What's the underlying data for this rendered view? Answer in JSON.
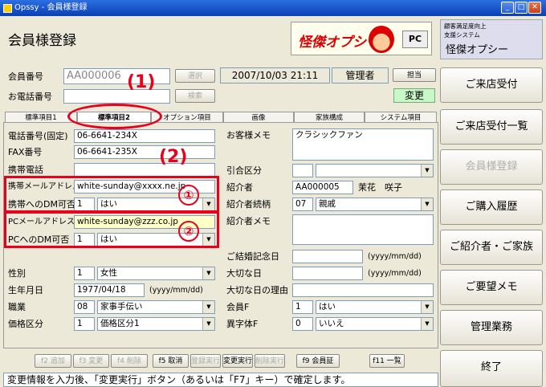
{
  "window": {
    "title": "Opssy - 会員様登録"
  },
  "header": {
    "page_title": "会員様登録",
    "logo_text": "怪傑オプシー",
    "pc_badge": "PC",
    "system_small1": "顧客満足度向上",
    "system_small2": "支援システム",
    "system_name": "怪傑オプシー"
  },
  "top": {
    "member_no_label": "会員番号",
    "member_no_value": "AA000006",
    "select_button": "選択",
    "datetime": "2007/10/03 21:11",
    "role": "管理者",
    "charge_button": "担当",
    "phone_label": "お電話番号",
    "search_button": "検索",
    "change_badge": "変更"
  },
  "tabs": [
    "標準項目1",
    "標準項目2",
    "オプション項目",
    "画像",
    "家族構成",
    "システム項目"
  ],
  "left": {
    "tel_label": "電話番号(固定)",
    "tel_value": "06-6641-234X",
    "fax_label": "FAX番号",
    "fax_value": "06-6641-235X",
    "mobile_label": "携帯電話",
    "mobile_value": "",
    "mobile_mail_label": "携帯メールアドレス",
    "mobile_mail_value": "white-sunday@xxxx.ne.jp",
    "mobile_dm_label": "携帯へのDM可否",
    "mobile_dm_code": "1",
    "mobile_dm_value": "はい",
    "pc_mail_label": "PCメールアドレス",
    "pc_mail_value": "white-sunday@zzz.co.jp",
    "pc_dm_label": "PCへのDM可否",
    "pc_dm_code": "1",
    "pc_dm_value": "はい",
    "gender_label": "性別",
    "gender_code": "1",
    "gender_value": "女性",
    "birth_label": "生年月日",
    "birth_value": "1977/04/18",
    "birth_hint": "(yyyy/mm/dd)",
    "job_label": "職業",
    "job_code": "08",
    "job_value": "家事手伝い",
    "price_label": "価格区分",
    "price_code": "1",
    "price_value": "価格区分1"
  },
  "right": {
    "memo_label": "お客様メモ",
    "memo_value": "クラシックファン",
    "transfer_label": "引合区分",
    "introducer_label": "紹介者",
    "introducer_no": "AA000005",
    "introducer_name": "茉花　咲子",
    "relation_label": "紹介者続柄",
    "relation_code": "07",
    "relation_value": "親戚",
    "introducer_memo_label": "紹介者メモ",
    "wedding_label": "ご結婚記念日",
    "wedding_hint": "(yyyy/mm/dd)",
    "important_label": "大切な日",
    "important_hint": "(yyyy/mm/dd)",
    "important_reason_label": "大切な日の理由",
    "member_f_label": "会員F",
    "member_f_code": "1",
    "member_f_value": "はい",
    "foreign_label": "異字体F",
    "foreign_code": "0",
    "foreign_value": "いいえ"
  },
  "annotations": {
    "n1": "(1)",
    "n2": "(2)",
    "c1": "①",
    "c2": "②"
  },
  "fkeys": [
    "f2 追加",
    "f3 変更",
    "f4 削除",
    "f5 取消",
    "登録実行",
    "変更実行",
    "削除実行",
    "f9 会員証",
    "f11 一覧"
  ],
  "status_message": "変更情報を入力後、「変更実行」ボタン（あるいは「F7」キー）で確定します。",
  "sidebar": [
    "ご来店受付",
    "ご来店受付一覧",
    "会員様登録",
    "ご購入履歴",
    "ご紹介者・ご家族",
    "ご要望メモ",
    "管理業務",
    "終了"
  ]
}
